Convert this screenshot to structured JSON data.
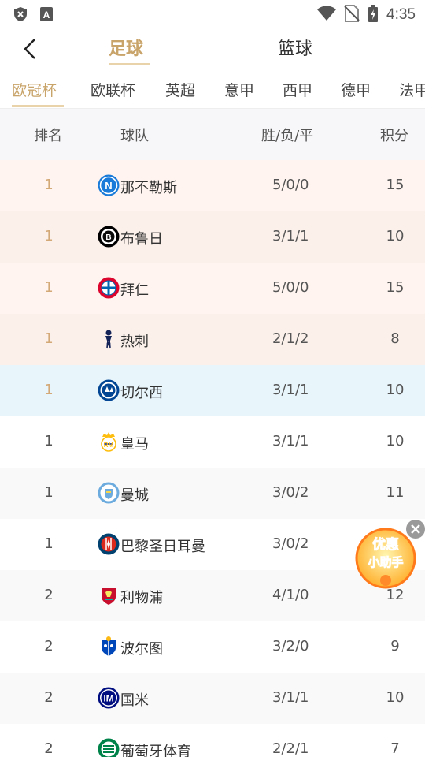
{
  "status_bar": {
    "time": "4:35"
  },
  "header": {
    "tabs": [
      {
        "label": "足球",
        "active": true
      },
      {
        "label": "篮球",
        "active": false
      }
    ]
  },
  "league_tabs": [
    "欧冠杯",
    "欧联杯",
    "英超",
    "意甲",
    "西甲",
    "德甲",
    "法甲"
  ],
  "table": {
    "headers": {
      "rank": "排名",
      "team": "球队",
      "record": "胜/负/平",
      "points": "积分"
    },
    "rows": [
      {
        "rank": "1",
        "team": "那不勒斯",
        "record": "5/0/0",
        "points": "15",
        "logo": "napoli-logo",
        "bg": "#fff4ef"
      },
      {
        "rank": "1",
        "team": "布鲁日",
        "record": "3/1/1",
        "points": "10",
        "logo": "club-brugge-logo",
        "bg": "#fbf0ea"
      },
      {
        "rank": "1",
        "team": "拜仁",
        "record": "5/0/0",
        "points": "15",
        "logo": "bayern-logo",
        "bg": "#fff4ef"
      },
      {
        "rank": "1",
        "team": "热刺",
        "record": "2/1/2",
        "points": "8",
        "logo": "tottenham-logo",
        "bg": "#fbf0ea"
      },
      {
        "rank": "1",
        "team": "切尔西",
        "record": "3/1/1",
        "points": "10",
        "logo": "chelsea-logo",
        "bg": "#e8f5fb"
      },
      {
        "rank": "1",
        "team": "皇马",
        "record": "3/1/1",
        "points": "10",
        "logo": "real-madrid-logo",
        "bg": "#ffffff"
      },
      {
        "rank": "1",
        "team": "曼城",
        "record": "3/0/2",
        "points": "11",
        "logo": "man-city-logo",
        "bg": "#f9f9f9"
      },
      {
        "rank": "1",
        "team": "巴黎圣日耳曼",
        "record": "3/0/2",
        "points": "",
        "logo": "psg-logo",
        "bg": "#ffffff"
      },
      {
        "rank": "2",
        "team": "利物浦",
        "record": "4/1/0",
        "points": "12",
        "logo": "liverpool-logo",
        "bg": "#f9f9f9"
      },
      {
        "rank": "2",
        "team": "波尔图",
        "record": "3/2/0",
        "points": "9",
        "logo": "porto-logo",
        "bg": "#ffffff"
      },
      {
        "rank": "2",
        "team": "国米",
        "record": "3/1/1",
        "points": "10",
        "logo": "inter-logo",
        "bg": "#f9f9f9"
      },
      {
        "rank": "2",
        "team": "葡萄牙体育",
        "record": "2/2/1",
        "points": "7",
        "logo": "sporting-logo",
        "bg": "#ffffff"
      }
    ]
  },
  "promo": {
    "line1": "优惠",
    "line2": "小助手"
  },
  "colors": {
    "accent": "#c9a46a",
    "top_rank": "#d4a978",
    "highlight_blue": "#e8f5fb"
  }
}
